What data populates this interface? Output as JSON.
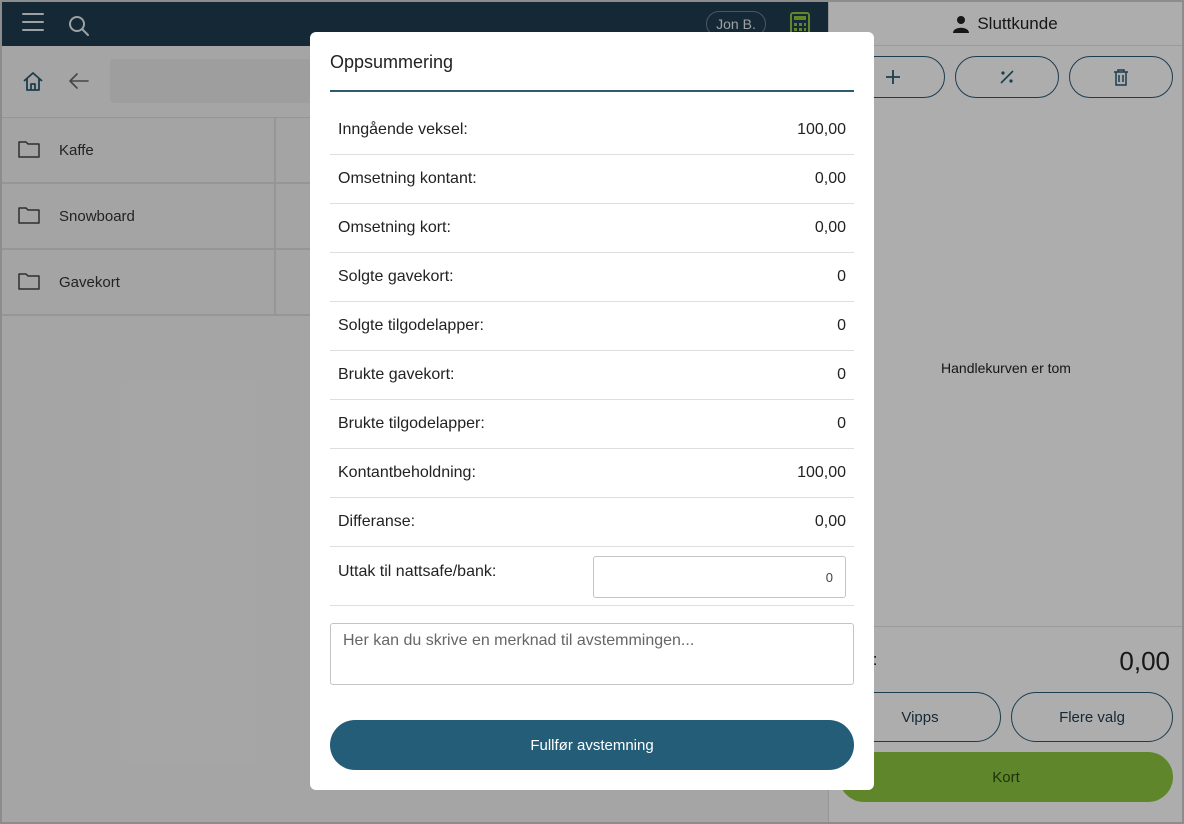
{
  "header": {
    "user": "Jon B."
  },
  "categories": [
    {
      "label": "Kaffe"
    },
    {
      "label": "Snowboard"
    },
    {
      "label": "Gavekort"
    }
  ],
  "cart": {
    "customer": "Sluttkunde",
    "empty_text": "Handlekurven er tom",
    "total_label": "l:",
    "total": "0,00",
    "buttons": {
      "vipps": "Vipps",
      "more": "Flere valg",
      "card": "Kort"
    }
  },
  "modal": {
    "title": "Oppsummering",
    "rows": [
      {
        "label": "Inngående veksel:",
        "value": "100,00"
      },
      {
        "label": "Omsetning kontant:",
        "value": "0,00"
      },
      {
        "label": "Omsetning kort:",
        "value": "0,00"
      },
      {
        "label": "Solgte gavekort:",
        "value": "0"
      },
      {
        "label": "Solgte tilgodelapper:",
        "value": "0"
      },
      {
        "label": "Brukte gavekort:",
        "value": "0"
      },
      {
        "label": "Brukte tilgodelapper:",
        "value": "0"
      },
      {
        "label": "Kontantbeholdning:",
        "value": "100,00"
      },
      {
        "label": "Differanse:",
        "value": "0,00"
      }
    ],
    "withdraw": {
      "label": "Uttak til nattsafe/bank:",
      "value": "0"
    },
    "note_placeholder": "Her kan du skrive en merknad til avstemmingen...",
    "finish_button": "Fullfør avstemning"
  },
  "colors": {
    "topbar": "#1f3c50",
    "primary": "#245d78",
    "card_button": "#8cc63f"
  },
  "icons": [
    "menu-icon",
    "search-icon",
    "calculator-icon",
    "home-icon",
    "back-arrow-icon",
    "folder-icon",
    "copy-icon",
    "user-icon",
    "plus-icon",
    "percent-icon",
    "trash-icon"
  ]
}
